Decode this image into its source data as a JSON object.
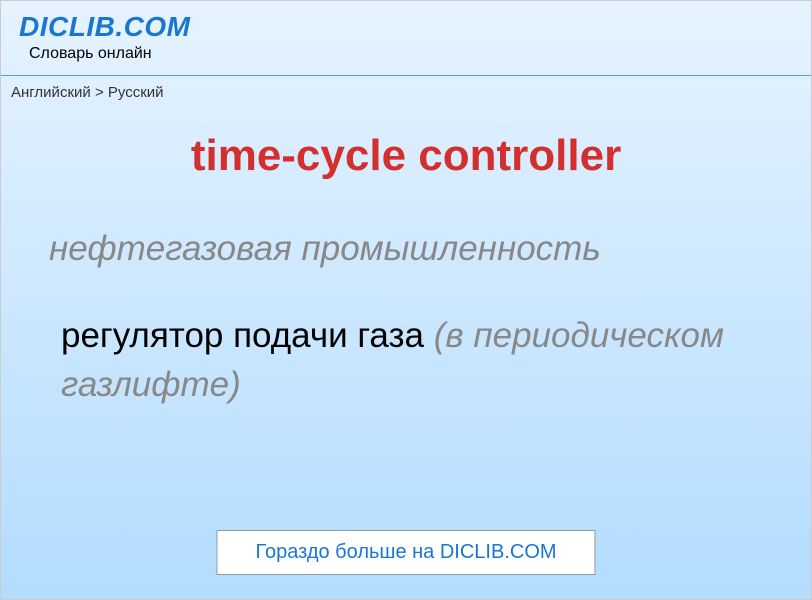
{
  "header": {
    "site_name": "DICLIB.COM",
    "subtitle": "Словарь онлайн"
  },
  "breadcrumb": {
    "from": "Английский",
    "separator": ">",
    "to": "Русский"
  },
  "term": "time-cycle controller",
  "category": "нефтегазовая промышленность",
  "definition": {
    "main": "регулятор подачи газа",
    "note": "(в периодическом газлифте)"
  },
  "cta": {
    "text": "Гораздо больше на DICLIB.COM"
  }
}
